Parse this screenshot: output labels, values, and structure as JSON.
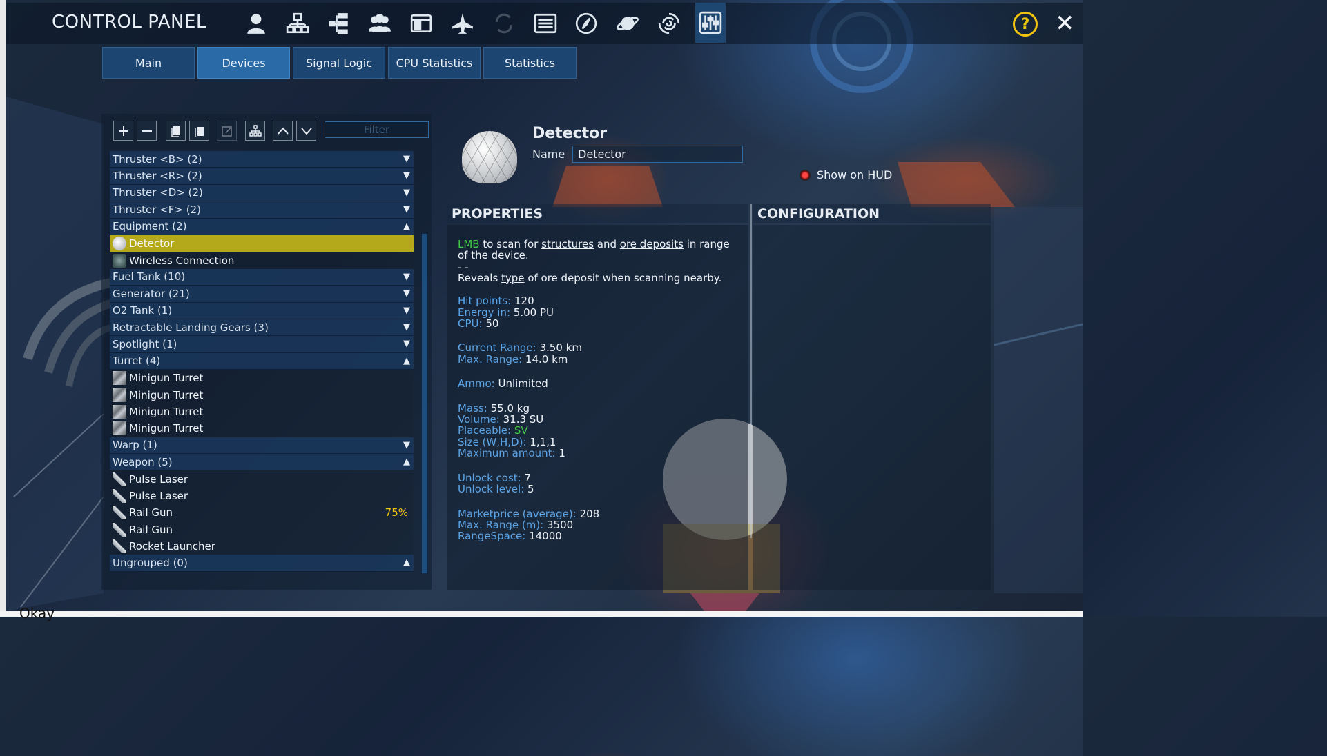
{
  "app": {
    "title": "CONTROL PANEL",
    "toolbar_icons": [
      "player-icon",
      "structure-icon",
      "tree-icon",
      "faction-icon",
      "window-icon",
      "ship-icon",
      "transfer-icon",
      "list-icon",
      "compass-icon",
      "planet-icon",
      "galaxy-icon",
      "sliders-icon"
    ],
    "active_icon": "sliders-icon",
    "help_label": "?",
    "close_label": "✕"
  },
  "tabs": [
    {
      "label": "Main"
    },
    {
      "label": "Devices"
    },
    {
      "label": "Signal Logic"
    },
    {
      "label": "CPU Statistics"
    },
    {
      "label": "Statistics"
    }
  ],
  "active_tab": "Devices",
  "filter": {
    "placeholder": "Filter",
    "value": ""
  },
  "device_list": [
    {
      "type": "group",
      "label": "Thruster <B> (2)",
      "expanded": false
    },
    {
      "type": "group",
      "label": "Thruster <R> (2)",
      "expanded": false
    },
    {
      "type": "group",
      "label": "Thruster <D> (2)",
      "expanded": false
    },
    {
      "type": "group",
      "label": "Thruster <F> (2)",
      "expanded": false
    },
    {
      "type": "group",
      "label": "Equipment (2)",
      "expanded": true
    },
    {
      "type": "item",
      "label": "Detector",
      "icon": "dome-icon",
      "selected": true
    },
    {
      "type": "item",
      "label": "Wireless Connection",
      "icon": "wireless-icon"
    },
    {
      "type": "group",
      "label": "Fuel Tank (10)",
      "expanded": false
    },
    {
      "type": "group",
      "label": "Generator (21)",
      "expanded": false
    },
    {
      "type": "group",
      "label": "O2 Tank (1)",
      "expanded": false
    },
    {
      "type": "group",
      "label": "Retractable Landing Gears (3)",
      "expanded": false
    },
    {
      "type": "group",
      "label": "Spotlight (1)",
      "expanded": false
    },
    {
      "type": "group",
      "label": "Turret (4)",
      "expanded": true
    },
    {
      "type": "item",
      "label": "Minigun Turret",
      "icon": "turret-icon"
    },
    {
      "type": "item",
      "label": "Minigun Turret",
      "icon": "turret-icon"
    },
    {
      "type": "item",
      "label": "Minigun Turret",
      "icon": "turret-icon"
    },
    {
      "type": "item",
      "label": "Minigun Turret",
      "icon": "turret-icon"
    },
    {
      "type": "group",
      "label": "Warp (1)",
      "expanded": false
    },
    {
      "type": "group",
      "label": "Weapon (5)",
      "expanded": true
    },
    {
      "type": "item",
      "label": "Pulse Laser",
      "icon": "weapon-icon"
    },
    {
      "type": "item",
      "label": "Pulse Laser",
      "icon": "weapon-icon"
    },
    {
      "type": "item",
      "label": "Rail Gun",
      "icon": "weapon-icon",
      "percent": "75%"
    },
    {
      "type": "item",
      "label": "Rail Gun",
      "icon": "weapon-icon"
    },
    {
      "type": "item",
      "label": "Rocket Launcher",
      "icon": "weapon-icon"
    },
    {
      "type": "group",
      "label": "Ungrouped (0)",
      "expanded": true
    }
  ],
  "detail": {
    "title": "Detector",
    "name_label": "Name",
    "name_value": "Detector",
    "show_on_hud_label": "Show on HUD",
    "properties_heading": "PROPERTIES",
    "configuration_heading": "CONFIGURATION",
    "description": {
      "lmb": "LMB",
      "line1_a": " to scan for ",
      "structures": "structures",
      "line1_b": " and ",
      "ore_deposits": "ore deposits",
      "line1_c": " in range of the device.",
      "dash": "- -",
      "line2_a": "Reveals ",
      "type": "type",
      "line2_b": " of ore deposit when scanning nearby."
    },
    "stats": [
      [
        {
          "key": "Hit points:",
          "value": " 120"
        },
        {
          "key": "Energy in:",
          "value": " 5.00 PU"
        },
        {
          "key": "CPU:",
          "value": " 50"
        }
      ],
      [
        {
          "key": "Current Range:",
          "value": " 3.50 km"
        },
        {
          "key": "Max. Range:",
          "value": " 14.0 km"
        }
      ],
      [
        {
          "key": "Ammo:",
          "value": " Unlimited"
        }
      ],
      [
        {
          "key": "Mass:",
          "value": " 55.0 kg"
        },
        {
          "key": "Volume:",
          "value": " 31.3 SU"
        },
        {
          "key": "Placeable:",
          "value": " SV",
          "value_green": true
        },
        {
          "key": "Size (W,H,D):",
          "value": " 1,1,1"
        },
        {
          "key": "Maximum amount:",
          "value": " 1"
        }
      ],
      [
        {
          "key": "Unlock cost:",
          "value": " 7"
        },
        {
          "key": "Unlock level:",
          "value": " 5"
        }
      ],
      [
        {
          "key": "Marketprice (average):",
          "value": " 208"
        },
        {
          "key": "Max. Range (m):",
          "value": " 3500"
        },
        {
          "key": "RangeSpace:",
          "value": " 14000"
        }
      ]
    ]
  },
  "background_text": "Okay"
}
